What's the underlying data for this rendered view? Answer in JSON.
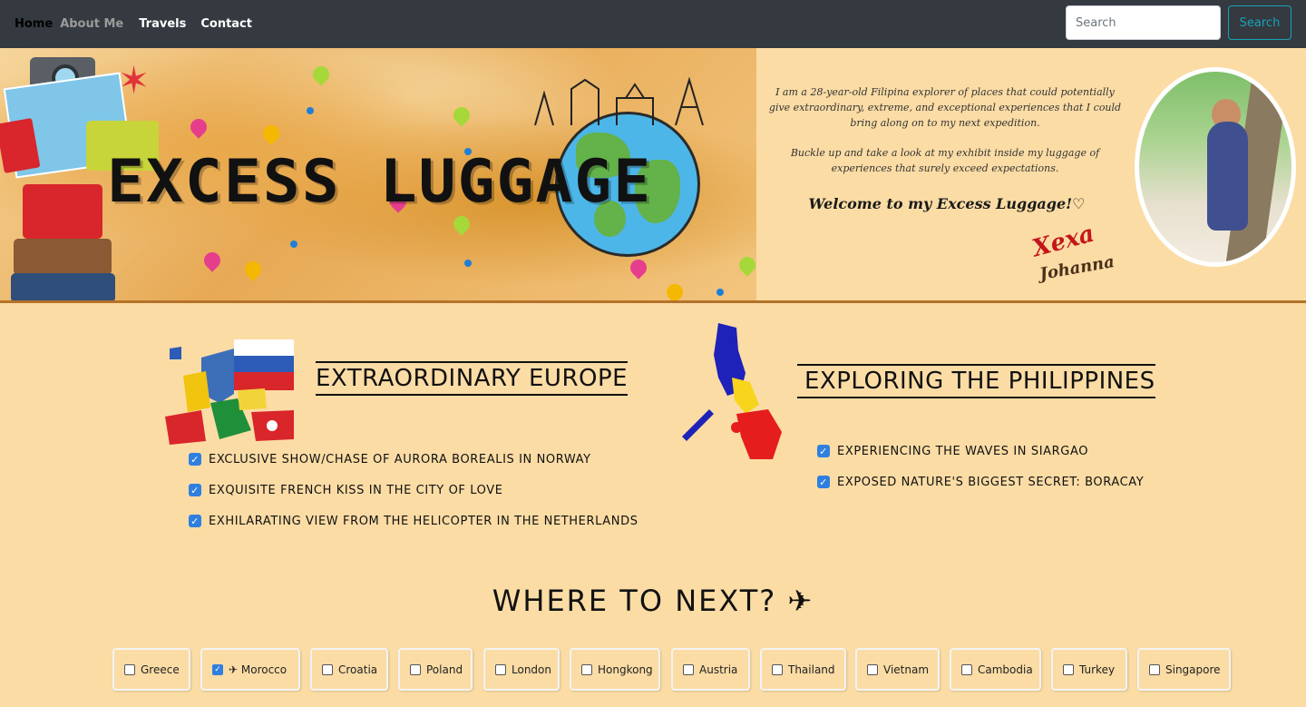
{
  "nav": {
    "links": [
      "Home",
      "About Me",
      "Travels",
      "Contact"
    ],
    "search_placeholder": "Search",
    "search_button": "Search"
  },
  "banner": {
    "title": "EXCESS LUGGAGE"
  },
  "intro": {
    "paragraph1": "I am a 28-year-old Filipina explorer of places that could potentially give extraordinary, extreme, and exceptional experiences that I could bring along on to my next expedition.",
    "paragraph2": "Buckle up and take a look at my exhibit inside my luggage of experiences that surely exceed expectations.",
    "welcome": "Welcome to my Excess Luggage!♡",
    "signature_line1": "Xexa",
    "signature_line2": "Johanna"
  },
  "europe": {
    "title": "EXTRAORDINARY EUROPE",
    "items": [
      "Exclusive show/chase of aurora borealis in Norway",
      "Exquisite French kiss in the City of Love",
      "Exhilarating view from the helicopter in the Netherlands"
    ]
  },
  "philippines": {
    "title": "EXPLORING THE PHILIPPINES",
    "items": [
      "Experiencing the waves in Siargao",
      "Exposed nature's biggest secret: Boracay"
    ]
  },
  "next": {
    "title": "WHERE TO NEXT? ✈",
    "destinations": [
      {
        "label": "Greece",
        "checked": false
      },
      {
        "label": "✈ Morocco",
        "checked": true
      },
      {
        "label": "Croatia",
        "checked": false
      },
      {
        "label": "Poland",
        "checked": false
      },
      {
        "label": "London",
        "checked": false
      },
      {
        "label": "Hongkong",
        "checked": false
      },
      {
        "label": "Austria",
        "checked": false
      },
      {
        "label": "Thailand",
        "checked": false
      },
      {
        "label": "Vietnam",
        "checked": false
      },
      {
        "label": "Cambodia",
        "checked": false
      },
      {
        "label": "Turkey",
        "checked": false
      },
      {
        "label": "Singapore",
        "checked": false
      }
    ]
  },
  "colors": {
    "navbar": "#343a40",
    "page_background": "#fbdca5",
    "accent_button": "#17a2b8",
    "checkbox": "#2f7fe0",
    "divider": "#b57229"
  }
}
